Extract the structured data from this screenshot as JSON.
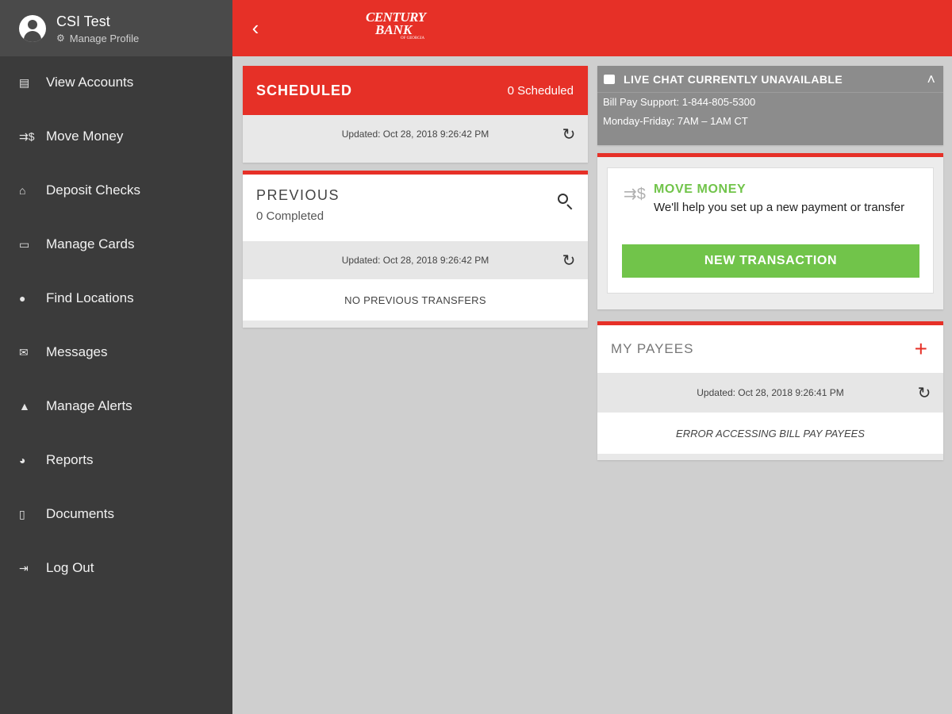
{
  "profile": {
    "name": "CSI Test",
    "manage_label": "Manage Profile"
  },
  "nav": [
    {
      "label": "View Accounts",
      "icon": "accounts-icon"
    },
    {
      "label": "Move Money",
      "icon": "money-transfer-icon"
    },
    {
      "label": "Deposit Checks",
      "icon": "bank-icon"
    },
    {
      "label": "Manage Cards",
      "icon": "cards-icon"
    },
    {
      "label": "Find Locations",
      "icon": "location-pin-icon"
    },
    {
      "label": "Messages",
      "icon": "mail-icon"
    },
    {
      "label": "Manage Alerts",
      "icon": "bell-icon"
    },
    {
      "label": "Reports",
      "icon": "pie-chart-icon"
    },
    {
      "label": "Documents",
      "icon": "document-icon"
    },
    {
      "label": "Log Out",
      "icon": "logout-icon"
    }
  ],
  "header": {
    "logo_line1": "CENTURY",
    "logo_line2": "BANK",
    "logo_line3": "OF GEORGIA"
  },
  "scheduled": {
    "title": "SCHEDULED",
    "count": "0 Scheduled",
    "updated": "Updated: Oct 28, 2018 9:26:42 PM"
  },
  "previous": {
    "title": "PREVIOUS",
    "subtitle": "0 Completed",
    "updated": "Updated: Oct 28, 2018 9:26:42 PM",
    "empty": "NO PREVIOUS TRANSFERS"
  },
  "chat": {
    "title": "LIVE CHAT CURRENTLY UNAVAILABLE",
    "support": "Bill Pay Support: 1-844-805-5300",
    "hours": "Monday-Friday: 7AM – 1AM CT"
  },
  "move_money": {
    "title": "MOVE MONEY",
    "description": "We'll help you set up a new payment or transfer",
    "button": "NEW TRANSACTION"
  },
  "payees": {
    "title": "MY PAYEES",
    "updated": "Updated: Oct 28, 2018 9:26:41 PM",
    "error": "ERROR ACCESSING BILL PAY PAYEES"
  },
  "colors": {
    "brand_red": "#e63027",
    "accent_green": "#71c44a",
    "sidebar": "#3b3b3b"
  }
}
